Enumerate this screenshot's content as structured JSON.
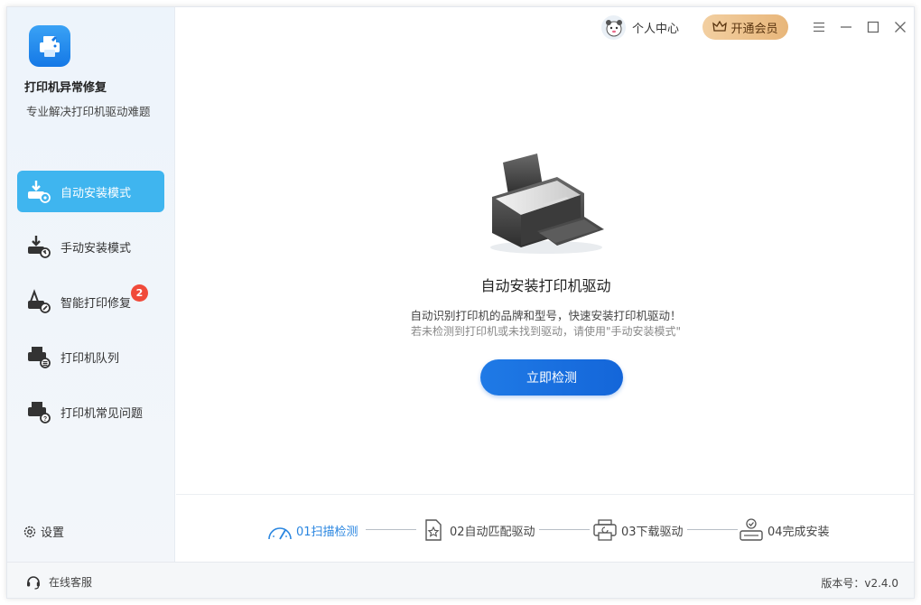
{
  "app": {
    "name": "打印机异常修复",
    "subtitle": "专业解决打印机驱动难题",
    "logo_icon": "printer-wrench-icon"
  },
  "header": {
    "user_center_label": "个人中心",
    "vip_label": "开通会员"
  },
  "sidebar": {
    "items": [
      {
        "label": "自动安装模式",
        "icon": "auto-install-icon",
        "active": true
      },
      {
        "label": "手动安装模式",
        "icon": "manual-install-icon",
        "active": false
      },
      {
        "label": "智能打印修复",
        "icon": "print-repair-icon",
        "active": false,
        "badge": "2"
      },
      {
        "label": "打印机队列",
        "icon": "printer-queue-icon",
        "active": false
      },
      {
        "label": "打印机常见问题",
        "icon": "printer-faq-icon",
        "active": false
      }
    ],
    "settings_label": "设置"
  },
  "main": {
    "title": "自动安装打印机驱动",
    "desc1": "自动识别打印机的品牌和型号，快速安装打印机驱动！",
    "desc2": "若未检测到打印机或未找到驱动，请使用\"手动安装模式\"",
    "detect_button": "立即检测"
  },
  "steps": [
    {
      "label": "01扫描检测",
      "icon": "scan-gauge-icon",
      "active": true
    },
    {
      "label": "02自动匹配驱动",
      "icon": "match-star-icon",
      "active": false
    },
    {
      "label": "03下载驱动",
      "icon": "download-printer-icon",
      "active": false
    },
    {
      "label": "04完成安装",
      "icon": "install-complete-icon",
      "active": false
    }
  ],
  "footer": {
    "online_service": "在线客服",
    "version": "版本号：v2.4.0"
  },
  "colors": {
    "accent": "#1f7ae6",
    "active_nav": "#3fb5ef",
    "badge": "#f04a3a",
    "vip_gold": "#e8b67a"
  }
}
